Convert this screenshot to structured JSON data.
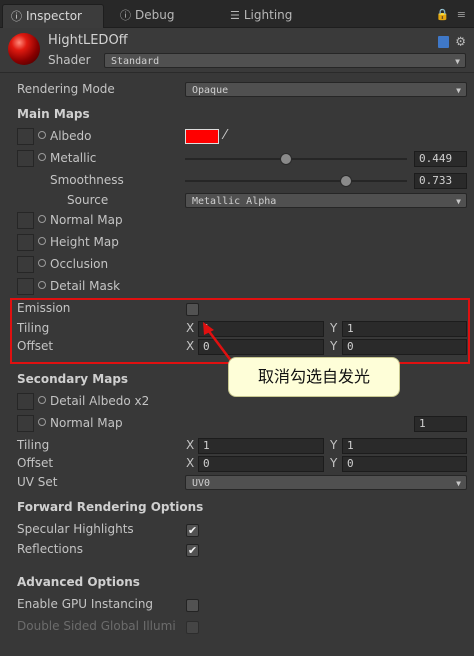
{
  "tabs": [
    {
      "label": "Inspector",
      "icon": "info-icon",
      "active": true
    },
    {
      "label": "Debug",
      "icon": "info-icon",
      "active": false
    },
    {
      "label": "Lighting",
      "icon": "lighting-icon",
      "active": false
    }
  ],
  "header": {
    "material_name": "HightLEDOff",
    "shader_label": "Shader",
    "shader_value": "Standard"
  },
  "rendering_mode": {
    "label": "Rendering Mode",
    "value": "Opaque"
  },
  "main_maps": {
    "title": "Main Maps",
    "albedo": {
      "label": "Albedo",
      "color": "#ff0000"
    },
    "metallic": {
      "label": "Metallic",
      "value": "0.449",
      "fraction": 0.449
    },
    "smoothness": {
      "label": "Smoothness",
      "value": "0.733",
      "fraction": 0.733
    },
    "source": {
      "label": "Source",
      "value": "Metallic Alpha"
    },
    "normal_map": "Normal Map",
    "height_map": "Height Map",
    "occlusion": "Occlusion",
    "detail_mask": "Detail Mask",
    "emission": {
      "label": "Emission",
      "checked": false
    },
    "tiling": {
      "label": "Tiling",
      "x_label": "X",
      "x": "1",
      "y_label": "Y",
      "y": "1"
    },
    "offset": {
      "label": "Offset",
      "x_label": "X",
      "x": "0",
      "y_label": "Y",
      "y": "0"
    }
  },
  "callout": {
    "text": "取消勾选自发光"
  },
  "secondary_maps": {
    "title": "Secondary Maps",
    "detail_albedo": "Detail Albedo x2",
    "normal_map": {
      "label": "Normal Map",
      "value": "1"
    },
    "tiling": {
      "label": "Tiling",
      "x_label": "X",
      "x": "1",
      "y_label": "Y",
      "y": "1"
    },
    "offset": {
      "label": "Offset",
      "x_label": "X",
      "x": "0",
      "y_label": "Y",
      "y": "0"
    },
    "uv_set": {
      "label": "UV Set",
      "value": "UV0"
    }
  },
  "forward_rendering": {
    "title": "Forward Rendering Options",
    "specular": {
      "label": "Specular Highlights",
      "checked": true
    },
    "reflections": {
      "label": "Reflections",
      "checked": true
    }
  },
  "advanced": {
    "title": "Advanced Options",
    "gpu_instancing": {
      "label": "Enable GPU Instancing",
      "checked": false
    },
    "double_sided": {
      "label": "Double Sided Global Illumi",
      "checked": false
    }
  },
  "colors": {
    "highlight": "#e01010",
    "callout_bg": "#fefed8",
    "albedo": "#ff0000"
  }
}
